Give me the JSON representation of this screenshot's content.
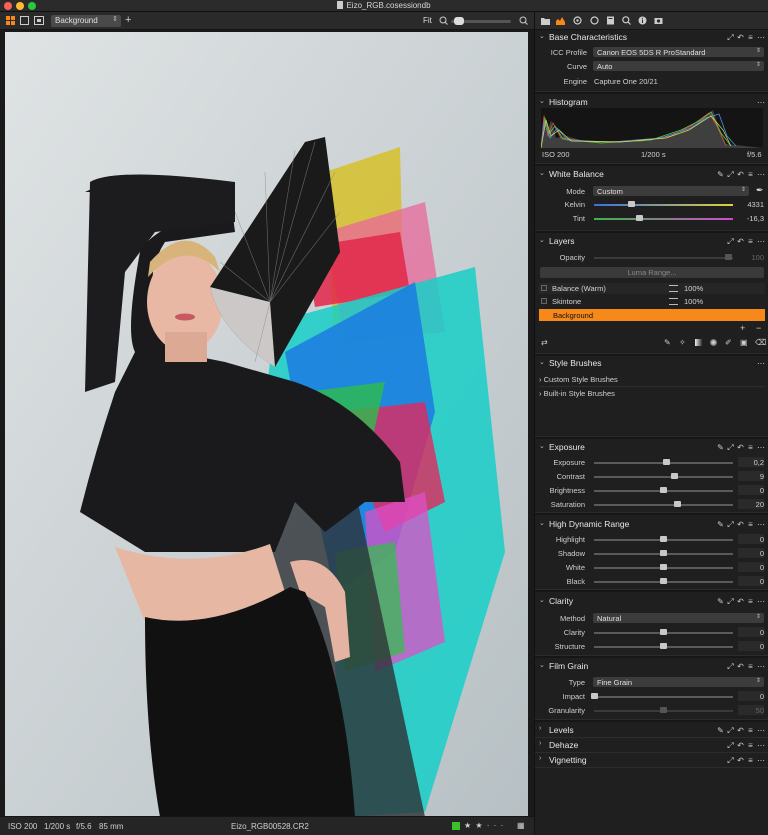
{
  "window": {
    "title": "Eizo_RGB.cosessiondb"
  },
  "toolbar": {
    "layer_selected": "Background",
    "zoom_label": "Fit",
    "zoom_level": 0.05
  },
  "status_bar": {
    "iso": "ISO 200",
    "shutter": "1/200 s",
    "aperture": "f/5.6",
    "focal_length": "85 mm",
    "filename": "Eizo_RGB00528.CR2",
    "color_tag": "#3bbf2b",
    "stars": "★ ★ · · ·"
  },
  "tool_tabs": [
    "library-icon",
    "capture-icon",
    "lens-icon",
    "color-icon",
    "exposure-icon",
    "details-icon",
    "adjustments-icon",
    "metadata-icon",
    "output-icon"
  ],
  "base_characteristics": {
    "title": "Base Characteristics",
    "rows": [
      {
        "label": "ICC Profile",
        "value": "Canon EOS 5DS R ProStandard"
      },
      {
        "label": "Curve",
        "value": "Auto"
      },
      {
        "label": "Engine",
        "value": "Capture One 20/21"
      }
    ]
  },
  "histogram": {
    "title": "Histogram",
    "iso": "ISO 200",
    "shutter": "1/200 s",
    "aperture": "f/5.6"
  },
  "white_balance": {
    "title": "White Balance",
    "mode_label": "Mode",
    "mode_value": "Custom",
    "kelvin_label": "Kelvin",
    "kelvin_value": "4331",
    "kelvin_pos": 0.27,
    "tint_label": "Tint",
    "tint_value": "-16,3",
    "tint_pos": 0.33
  },
  "layers": {
    "title": "Layers",
    "opacity_label": "Opacity",
    "opacity_value": "100",
    "luma_label": "Luma Range...",
    "items": [
      {
        "name": "Balance (Warm)",
        "opacity": "100%"
      },
      {
        "name": "Skintone",
        "opacity": "100%"
      }
    ],
    "background_layer": "Background",
    "accent": "#f7891a"
  },
  "style_brushes": {
    "title": "Style Brushes",
    "items": [
      "Custom Style Brushes",
      "Built-in Style Brushes"
    ]
  },
  "exposure": {
    "title": "Exposure",
    "rows": [
      {
        "label": "Exposure",
        "value": "0,2",
        "pos": 0.52
      },
      {
        "label": "Contrast",
        "value": "9",
        "pos": 0.58
      },
      {
        "label": "Brightness",
        "value": "0",
        "pos": 0.5
      },
      {
        "label": "Saturation",
        "value": "20",
        "pos": 0.6
      }
    ]
  },
  "hdr": {
    "title": "High Dynamic Range",
    "rows": [
      {
        "label": "Highlight",
        "value": "0",
        "pos": 0.5
      },
      {
        "label": "Shadow",
        "value": "0",
        "pos": 0.5
      },
      {
        "label": "White",
        "value": "0",
        "pos": 0.5
      },
      {
        "label": "Black",
        "value": "0",
        "pos": 0.5
      }
    ]
  },
  "clarity": {
    "title": "Clarity",
    "method_label": "Method",
    "method_value": "Natural",
    "rows": [
      {
        "label": "Clarity",
        "value": "0",
        "pos": 0.5
      },
      {
        "label": "Structure",
        "value": "0",
        "pos": 0.5
      }
    ]
  },
  "film_grain": {
    "title": "Film Grain",
    "type_label": "Type",
    "type_value": "Fine Grain",
    "impact_label": "Impact",
    "impact_value": "0",
    "impact_pos": 0.0,
    "granularity_label": "Granularity",
    "granularity_value": "50",
    "granularity_pos": 0.5
  },
  "collapsed_tools": [
    "Levels",
    "Dehaze",
    "Vignetting"
  ]
}
